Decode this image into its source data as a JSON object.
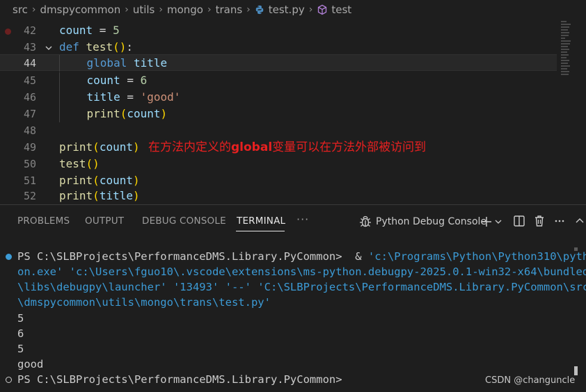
{
  "breadcrumb": {
    "items": [
      "src",
      "dmspycommon",
      "utils",
      "mongo",
      "trans"
    ],
    "file": "test.py",
    "symbol": "test"
  },
  "editor": {
    "lines": [
      {
        "num": "42"
      },
      {
        "num": "43"
      },
      {
        "num": "44"
      },
      {
        "num": "45"
      },
      {
        "num": "46"
      },
      {
        "num": "47"
      },
      {
        "num": "48"
      },
      {
        "num": "49"
      },
      {
        "num": "50"
      },
      {
        "num": "51"
      },
      {
        "num": "52"
      }
    ],
    "code": {
      "l42": {
        "name": "count",
        "eq": " = ",
        "val": "5"
      },
      "l43": {
        "kw": "def",
        "name": "test",
        "open": "(",
        "close": ")",
        "colon": ":"
      },
      "l44": {
        "kw": "global",
        "name": "title"
      },
      "l45": {
        "name": "count",
        "eq": " = ",
        "val": "6"
      },
      "l46": {
        "name": "title",
        "eq": " = ",
        "val": "'good'"
      },
      "l47": {
        "fn": "print",
        "open": "(",
        "arg": "count",
        "close": ")"
      },
      "l49": {
        "fn": "print",
        "open": "(",
        "arg": "count",
        "close": ")"
      },
      "l50": {
        "fn": "test",
        "open": "(",
        "close": ")"
      },
      "l51": {
        "fn": "print",
        "open": "(",
        "arg": "count",
        "close": ")"
      },
      "l52": {
        "fn": "print",
        "open": "(",
        "arg": "title",
        "close": ")"
      }
    },
    "annotation": {
      "pre": "在方法内定义的",
      "bold": "global",
      "post": "变量可以在方法外部被访问到"
    }
  },
  "panel": {
    "tabs": [
      "PROBLEMS",
      "OUTPUT",
      "DEBUG CONSOLE",
      "TERMINAL"
    ],
    "more": "···",
    "active_tab": "TERMINAL",
    "session": "Python Debug Console"
  },
  "terminal": {
    "prompt": "PS C:\\SLBProjects\\PerformanceDMS.Library.PyCommon> ",
    "amp": " & ",
    "cmd": [
      "'c:\\Programs\\Python\\Python310\\pyth",
      "on.exe' 'c:\\Users\\fguo10\\.vscode\\extensions\\ms-python.debugpy-2025.0.1-win32-x64\\bundled",
      "\\libs\\debugpy\\launcher' '13493' '--' 'C:\\SLBProjects\\PerformanceDMS.Library.PyCommon\\src",
      "\\dmspycommon\\utils\\mongo\\trans\\test.py'"
    ],
    "outputs": [
      "5",
      "6",
      "5",
      "good"
    ],
    "final_prompt": "PS C:\\SLBProjects\\PerformanceDMS.Library.PyCommon>"
  },
  "watermark": "CSDN @changuncle",
  "colors": {
    "keyword": "#569cd6",
    "function": "#dcdcaa",
    "variable": "#9cdcfe",
    "number": "#b5cea8",
    "string": "#ce9178",
    "annotation": "#e82020",
    "terminal_path": "#3c9bd6"
  }
}
